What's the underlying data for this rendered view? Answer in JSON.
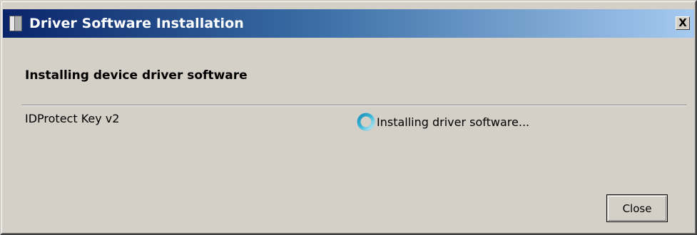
{
  "window": {
    "title": "Driver Software Installation",
    "icon": "driver-installer-icon",
    "close_glyph": "X"
  },
  "main": {
    "heading": "Installing device driver software",
    "device": {
      "name": "IDProtect Key v2",
      "status_icon": "busy-spinner-icon",
      "status": "Installing driver software..."
    }
  },
  "buttons": {
    "close_label": "Close"
  },
  "colors": {
    "dialog_background": "#d4d0c8",
    "titlebar_start": "#0a246a",
    "titlebar_end": "#a6caf0",
    "title_text": "#ffffff",
    "spinner_accent": "#3cb8d8"
  }
}
